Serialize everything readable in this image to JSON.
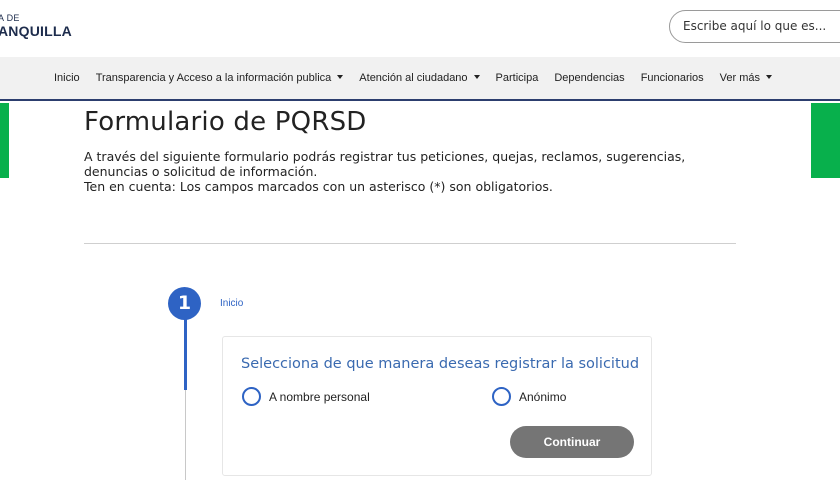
{
  "header": {
    "logo_line1": "A DE",
    "logo_line2": "ANQUILLA",
    "search": {
      "value": "Escribe aquí lo que es..."
    }
  },
  "nav": {
    "items": [
      {
        "label": "Inicio",
        "dropdown": false
      },
      {
        "label": "Transparencia y Acceso a la información publica",
        "dropdown": true
      },
      {
        "label": "Atención al ciudadano",
        "dropdown": true
      },
      {
        "label": "Participa",
        "dropdown": false
      },
      {
        "label": "Dependencias",
        "dropdown": false
      },
      {
        "label": "Funcionarios",
        "dropdown": false
      },
      {
        "label": "Ver más",
        "dropdown": true
      }
    ]
  },
  "page": {
    "title": "Formulario de PQRSD",
    "intro_line1": "A través del siguiente formulario podrás registrar tus peticiones, quejas, reclamos, sugerencias, denuncias o solicitud de información.",
    "intro_line2": "Ten en cuenta: Los campos marcados con un asterisco (*) son obligatorios."
  },
  "stepper": {
    "step_number": "1",
    "step_label": "Inicio"
  },
  "form": {
    "title": "Selecciona de que manera deseas registrar la solicitud",
    "options": [
      {
        "label": "A nombre personal",
        "selected": false
      },
      {
        "label": "Anónimo",
        "selected": false
      }
    ],
    "continue_label": "Continuar"
  },
  "colors": {
    "accent_blue": "#2e63c4",
    "brand_green": "#08b04c",
    "nav_border": "#2c3e6e",
    "button_gray": "#757575"
  }
}
